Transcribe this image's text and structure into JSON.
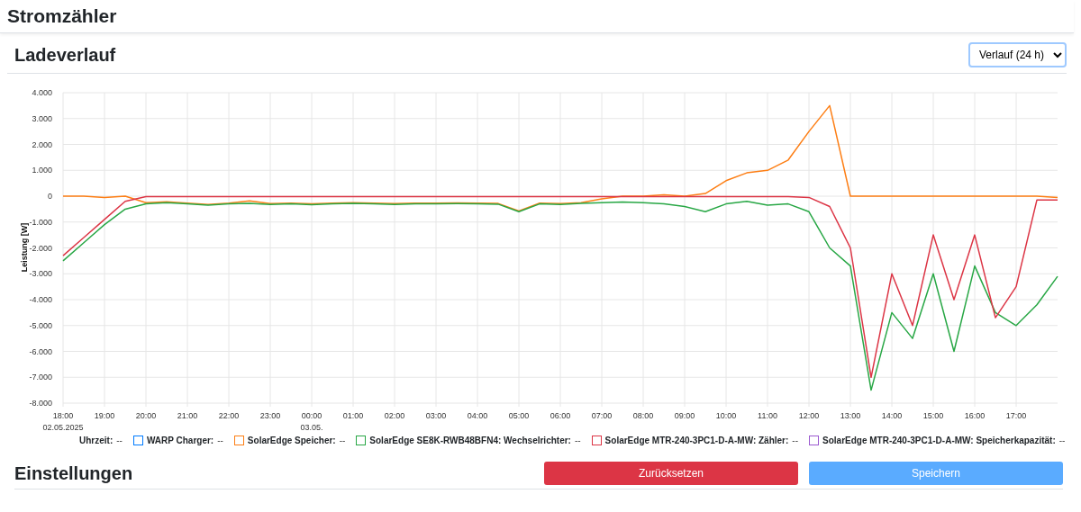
{
  "page_title": "Stromzähler",
  "history": {
    "title": "Ladeverlauf",
    "range_select": {
      "value": "Verlauf (24 h)"
    },
    "chart_data": {
      "type": "line",
      "grid": true,
      "ylabel": "Leistung [W]",
      "ylim": [
        -8000,
        4000
      ],
      "yticks": [
        {
          "value": 4000,
          "label": "4.000"
        },
        {
          "value": 3000,
          "label": "3.000"
        },
        {
          "value": 2000,
          "label": "2.000"
        },
        {
          "value": 1000,
          "label": "1.000"
        },
        {
          "value": 0,
          "label": "0"
        },
        {
          "value": -1000,
          "label": "-1.000"
        },
        {
          "value": -2000,
          "label": "-2.000"
        },
        {
          "value": -3000,
          "label": "-3.000"
        },
        {
          "value": -4000,
          "label": "-4.000"
        },
        {
          "value": -5000,
          "label": "-5.000"
        },
        {
          "value": -6000,
          "label": "-6.000"
        },
        {
          "value": -7000,
          "label": "-7.000"
        },
        {
          "value": -8000,
          "label": "-8.000"
        }
      ],
      "categories": [
        "18:00",
        null,
        "19:00",
        null,
        "20:00",
        null,
        "21:00",
        null,
        "22:00",
        null,
        "23:00",
        null,
        "00:00",
        null,
        "01:00",
        null,
        "02:00",
        null,
        "03:00",
        null,
        "04:00",
        null,
        "05:00",
        null,
        "06:00",
        null,
        "07:00",
        null,
        "08:00",
        null,
        "09:00",
        null,
        "10:00",
        null,
        "11:00",
        null,
        "12:00",
        null,
        "13:00",
        null,
        "14:00",
        null,
        "15:00",
        null,
        "16:00",
        null,
        "17:00",
        null,
        null
      ],
      "annotations": [
        "02.05.2025",
        "03.05."
      ],
      "series": [
        {
          "name": "WARP Charger:",
          "color": "#007bff",
          "values": [
            null,
            null,
            null,
            null,
            null,
            null,
            null,
            null,
            null,
            null,
            null,
            null,
            null,
            null,
            null,
            null,
            null,
            null,
            null,
            null,
            null,
            null,
            null,
            null,
            null,
            null,
            null,
            null,
            null,
            null,
            null,
            null,
            null,
            null,
            null,
            null,
            null,
            null,
            null,
            null,
            null,
            null,
            null,
            null,
            null,
            null,
            null,
            null,
            null
          ]
        },
        {
          "name": "SolarEdge Speicher:",
          "color": "#fd7e14",
          "values": [
            0,
            0,
            -50,
            0,
            -250,
            -220,
            -270,
            -320,
            -270,
            -180,
            -290,
            -270,
            -300,
            -270,
            -250,
            -270,
            -290,
            -270,
            -270,
            -260,
            -270,
            -280,
            -570,
            -270,
            -290,
            -250,
            -100,
            0,
            0,
            50,
            0,
            100,
            600,
            900,
            1000,
            1400,
            2500,
            3500,
            0,
            0,
            0,
            0,
            0,
            0,
            0,
            0,
            0,
            0,
            -50
          ]
        },
        {
          "name": "SolarEdge SE8K-RWB48BFN4: Wechselrichter:",
          "color": "#28a745",
          "values": [
            -2500,
            -1800,
            -1100,
            -500,
            -300,
            -250,
            -300,
            -350,
            -300,
            -280,
            -320,
            -300,
            -330,
            -300,
            -280,
            -300,
            -320,
            -300,
            -300,
            -290,
            -300,
            -310,
            -600,
            -300,
            -320,
            -280,
            -250,
            -230,
            -250,
            -300,
            -400,
            -600,
            -300,
            -200,
            -350,
            -300,
            -600,
            -2000,
            -2700,
            -7500,
            -4500,
            -5500,
            -3000,
            -6000,
            -2700,
            -4500,
            -5000,
            -4200,
            -3100
          ]
        },
        {
          "name": "SolarEdge MTR-240-3PC1-D-A-MW: Zähler:",
          "color": "#dc3545",
          "values": [
            -2300,
            -1600,
            -900,
            -200,
            -20,
            -20,
            -20,
            -20,
            -20,
            -20,
            -20,
            -20,
            -20,
            -20,
            -20,
            -20,
            -20,
            -20,
            -20,
            -20,
            -20,
            -20,
            -20,
            -20,
            -20,
            -20,
            -20,
            -20,
            -20,
            -20,
            -20,
            -20,
            -20,
            -20,
            -20,
            -20,
            -50,
            -400,
            -2000,
            -7000,
            -3000,
            -5000,
            -1500,
            -4000,
            -1500,
            -4700,
            -3500,
            -150,
            -150
          ]
        },
        {
          "name": "SolarEdge MTR-240-3PC1-D-A-MW: Speicherkapazität:",
          "color": "#9b59d0",
          "values": [
            null,
            null,
            null,
            null,
            null,
            null,
            null,
            null,
            null,
            null,
            null,
            null,
            null,
            null,
            null,
            null,
            null,
            null,
            null,
            null,
            null,
            null,
            null,
            null,
            null,
            null,
            null,
            null,
            null,
            null,
            null,
            null,
            null,
            null,
            null,
            null,
            null,
            null,
            null,
            null,
            null,
            null,
            null,
            null,
            null,
            null,
            null,
            null,
            null
          ]
        }
      ]
    },
    "legend": {
      "time_label": "Uhrzeit:",
      "time_value": "--",
      "readings": [
        "--",
        "--",
        "--",
        "--",
        "--"
      ]
    }
  },
  "settings": {
    "title": "Einstellungen",
    "buttons": [
      {
        "kind": "reset",
        "label": "Zurücksetzen"
      },
      {
        "kind": "save",
        "label": "Speichern"
      }
    ]
  }
}
